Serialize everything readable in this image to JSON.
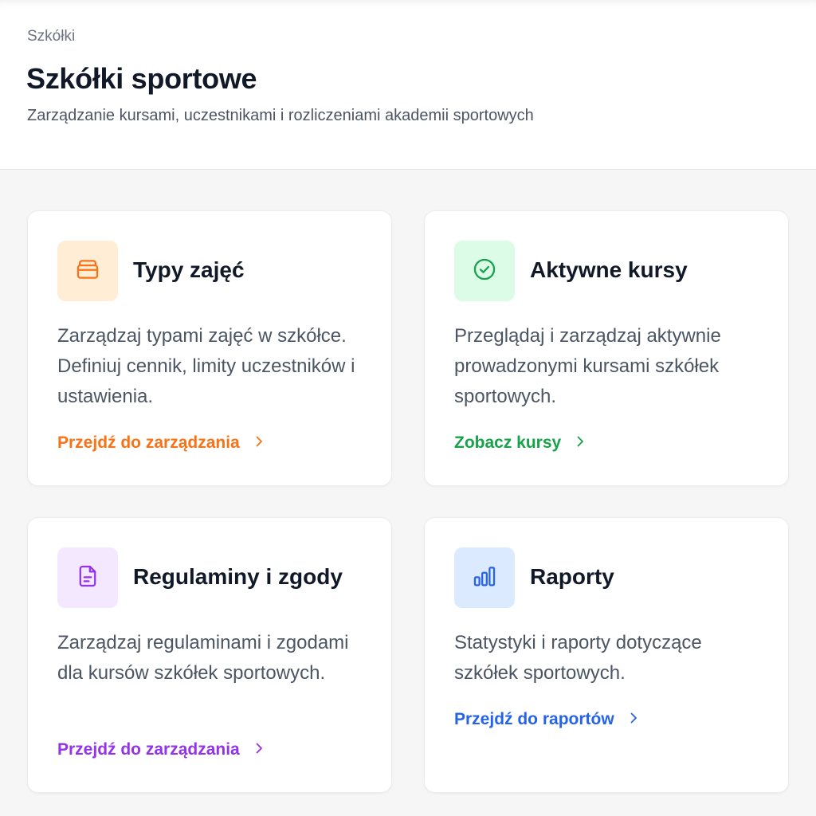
{
  "header": {
    "breadcrumb": "Szkółki",
    "title": "Szkółki sportowe",
    "subtitle": "Zarządzanie kursami, uczestnikami i rozliczeniami akademii sportowych"
  },
  "cards": [
    {
      "title": "Typy zajęć",
      "description": "Zarządzaj typami zajęć w szkółce. Definiuj cennik, limity uczestników i ustawienia.",
      "link": "Przejdź do zarządzania",
      "icon": "box-icon",
      "accent": "#f97316",
      "icon_bg": "#ffedd5"
    },
    {
      "title": "Aktywne kursy",
      "description": "Przeglądaj i zarządzaj aktywnie prowadzonymi kursami szkółek sportowych.",
      "link": "Zobacz kursy",
      "icon": "check-circle-icon",
      "accent": "#16a34a",
      "icon_bg": "#dcfce7"
    },
    {
      "title": "Regulaminy i zgody",
      "description": "Zarządzaj regulaminami i zgodami dla kursów szkółek sportowych.",
      "link": "Przejdź do zarządzania",
      "icon": "document-icon",
      "accent": "#9333ea",
      "icon_bg": "#f3e8ff"
    },
    {
      "title": "Raporty",
      "description": "Statystyki i raporty dotyczące szkółek sportowych.",
      "link": "Przejdź do raportów",
      "icon": "bar-chart-icon",
      "accent": "#2563eb",
      "icon_bg": "#dbeafe"
    }
  ]
}
